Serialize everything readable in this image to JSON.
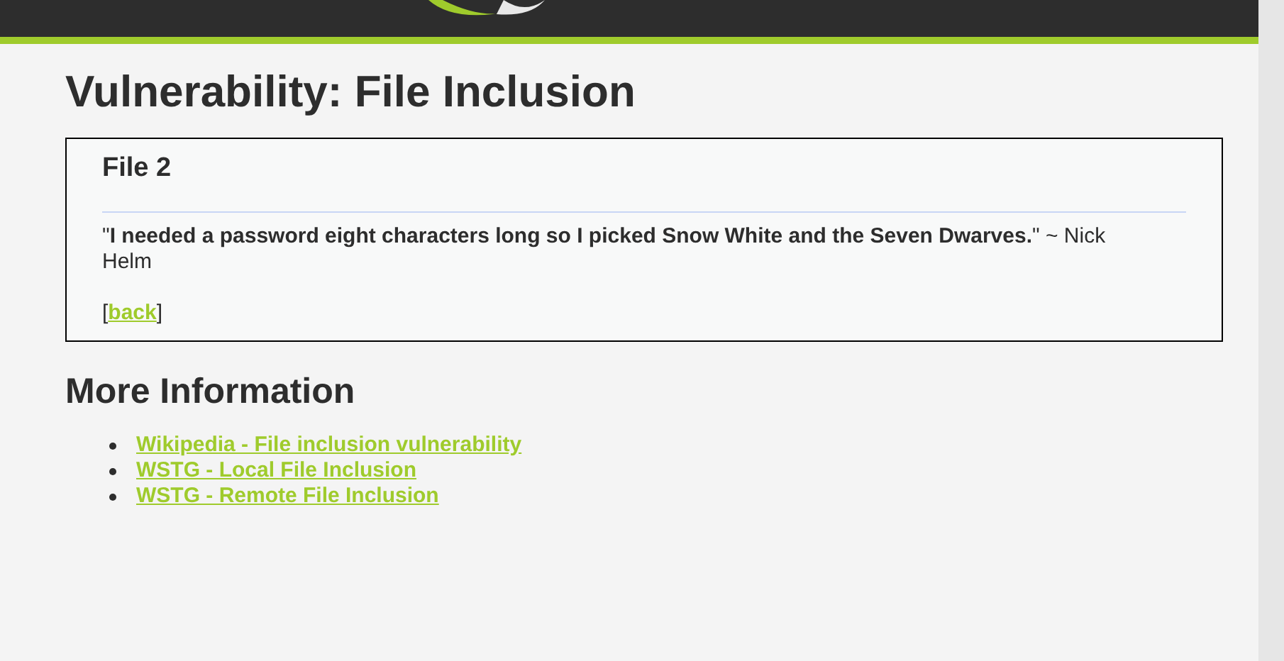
{
  "page": {
    "title": "Vulnerability: File Inclusion"
  },
  "file_box": {
    "heading": "File 2",
    "quote": "\"**I needed a password eight characters long so I picked Snow White and the Seven Dwarves.**\" ~ Nick Helm",
    "back_open": "[",
    "back_link": "back",
    "back_close": "]"
  },
  "more_information": {
    "heading": "More Information",
    "links": [
      "Wikipedia - File inclusion vulnerability",
      "WSTG - Local File Inclusion",
      "WSTG - Remote File Inclusion"
    ]
  }
}
